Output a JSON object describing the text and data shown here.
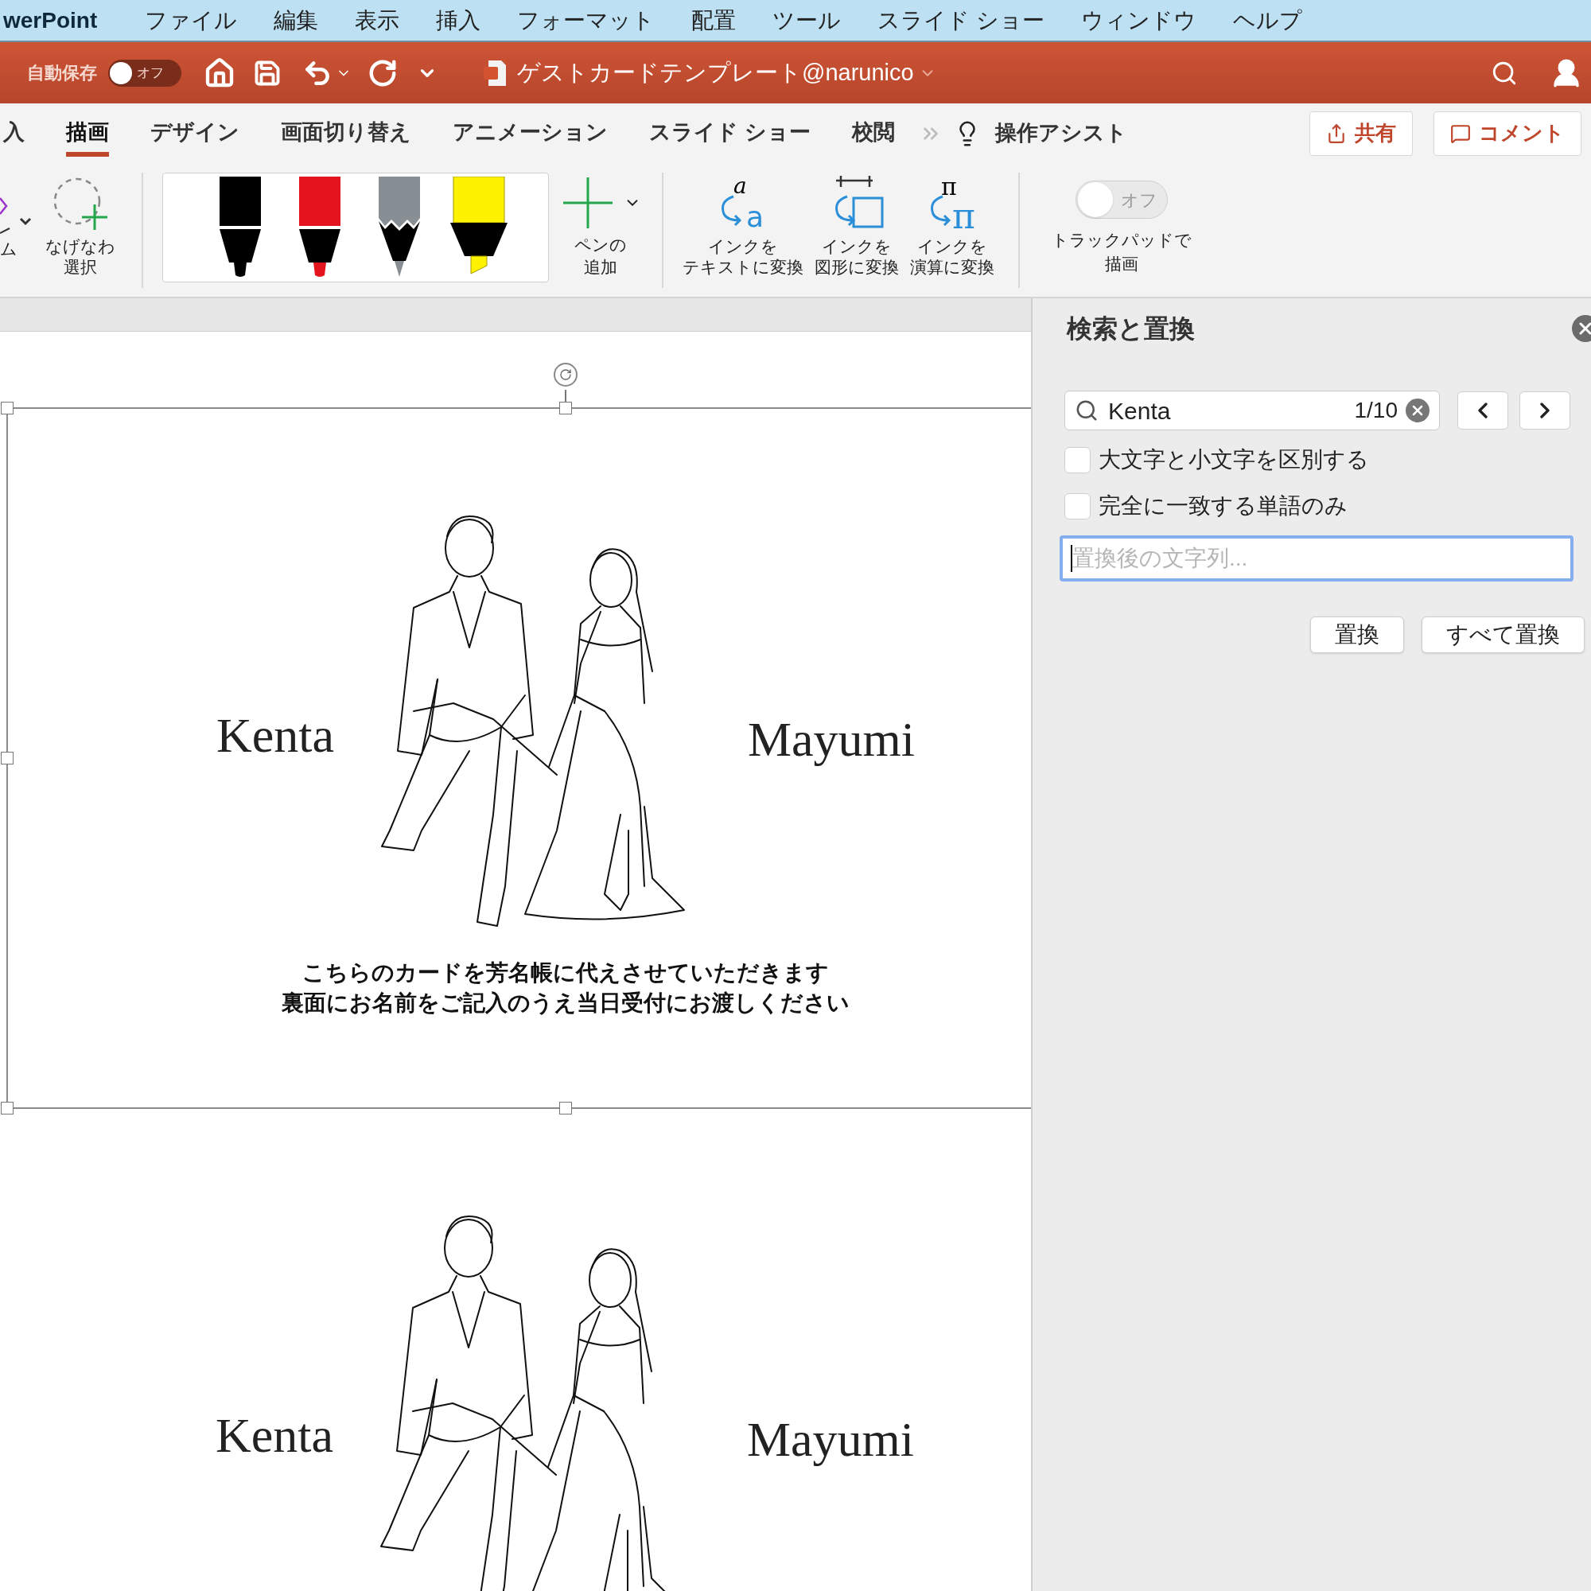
{
  "menu_bar": {
    "app_name": "werPoint",
    "items": [
      "ファイル",
      "編集",
      "表示",
      "挿入",
      "フォーマット",
      "配置",
      "ツール",
      "スライド ショー",
      "ウィンドウ",
      "ヘルプ"
    ]
  },
  "title_bar": {
    "autosave_label": "自動保存",
    "autosave_toggle": {
      "label": "オフ",
      "on": false
    },
    "document_title": "ゲストカードテンプレート@narunico"
  },
  "ribbon_tabs": [
    {
      "label": "入",
      "selected": false
    },
    {
      "label": "描画",
      "selected": true
    },
    {
      "label": "デザイン",
      "selected": false
    },
    {
      "label": "画面切り替え",
      "selected": false
    },
    {
      "label": "アニメーション",
      "selected": false
    },
    {
      "label": "スライド ショー",
      "selected": false
    },
    {
      "label": "校閲",
      "selected": false
    }
  ],
  "tell_me": "操作アシスト",
  "share_button": "共有",
  "comment_button": "コメント",
  "ribbon": {
    "eraser_label": "ム",
    "lasso_label": [
      "なげなわ",
      "選択"
    ],
    "pens": [
      {
        "kind": "pen",
        "color": "#000000",
        "selected": false
      },
      {
        "kind": "pen",
        "color": "#e3141e",
        "selected": false
      },
      {
        "kind": "pencil",
        "color": "#888f94",
        "selected": false
      },
      {
        "kind": "highlighter",
        "color": "#fff200",
        "selected": false
      }
    ],
    "add_pen_label": [
      "ペンの",
      "追加"
    ],
    "convert_buttons": [
      {
        "kind": "text",
        "icon_glyphs": [
          "a",
          "a"
        ],
        "label": [
          "インクを",
          "テキストに変換"
        ]
      },
      {
        "kind": "shape",
        "label": [
          "インクを",
          "図形に変換"
        ]
      },
      {
        "kind": "math",
        "icon_glyphs": [
          "π",
          "π"
        ],
        "label": [
          "インクを",
          "演算に変換"
        ]
      }
    ],
    "trackpad_toggle": {
      "label": "オフ",
      "on": false
    },
    "trackpad_label": [
      "トラックパッドで",
      "描画"
    ]
  },
  "slides": [
    {
      "left_name": "Kenta",
      "right_name": "Mayumi",
      "selected": true,
      "message_lines": [
        "こちらのカードを芳名帳に代えさせていただきます",
        "裏面にお名前をご記入のうえ当日受付にお渡しください"
      ]
    },
    {
      "left_name": "Kenta",
      "right_name": "Mayumi",
      "selected": false
    }
  ],
  "find_panel": {
    "title": "検索と置換",
    "search_value": "Kenta",
    "match_count": "1/10",
    "options": [
      {
        "label": "大文字と小文字を区別する",
        "checked": false
      },
      {
        "label": "完全に一致する単語のみ",
        "checked": false
      }
    ],
    "replace_placeholder": "置換後の文字列...",
    "buttons": [
      "置換",
      "すべて置換"
    ]
  }
}
